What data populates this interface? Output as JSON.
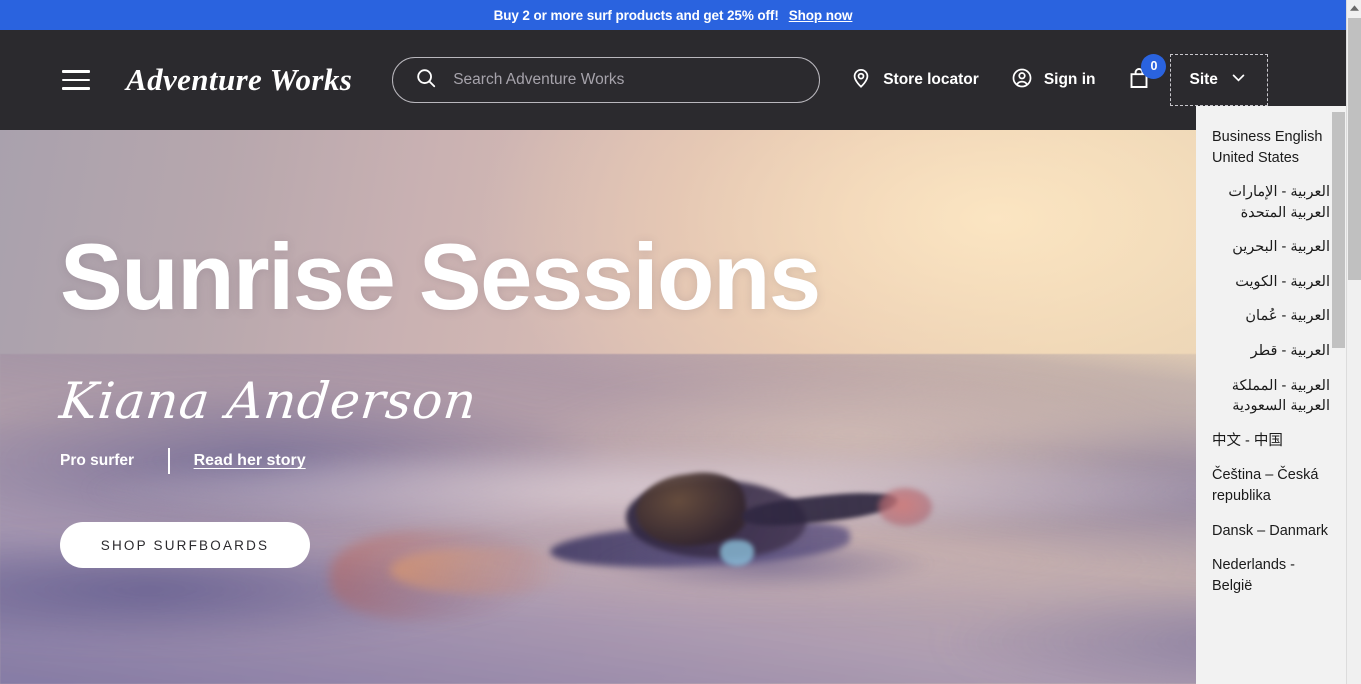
{
  "promo": {
    "text": "Buy 2 or more surf products and get 25% off!",
    "link_label": "Shop now",
    "background_color": "#2a63df"
  },
  "header": {
    "background_color": "#2b2a2e",
    "menu_icon": "hamburger-icon",
    "brand": "Adventure Works",
    "search": {
      "placeholder": "Search Adventure Works",
      "value": "",
      "icon": "search-icon"
    },
    "store_locator": {
      "label": "Store locator",
      "icon": "map-pin-icon"
    },
    "sign_in": {
      "label": "Sign in",
      "icon": "account-circle-icon"
    },
    "cart": {
      "icon": "shopping-bag-icon",
      "count": "0",
      "badge_color": "#2a63df"
    },
    "site_selector": {
      "label": "Site",
      "icon": "chevron-down-icon",
      "expanded": true
    }
  },
  "hero": {
    "title": "Sunrise Sessions",
    "signature": "Kiana Anderson",
    "role": "Pro surfer",
    "story_link": "Read her story",
    "cta_label": "SHOP SURFBOARDS"
  },
  "site_dropdown": {
    "items": [
      {
        "label": "Business English United States",
        "rtl": false
      },
      {
        "label": "العربية - الإمارات العربية المتحدة",
        "rtl": true
      },
      {
        "label": "العربية - البحرين",
        "rtl": true
      },
      {
        "label": "العربية - الكويت",
        "rtl": true
      },
      {
        "label": "العربية - عُمان",
        "rtl": true
      },
      {
        "label": "العربية - قطر",
        "rtl": true
      },
      {
        "label": "العربية - المملكة العربية السعودية",
        "rtl": true
      },
      {
        "label": "中文 - 中国",
        "rtl": false
      },
      {
        "label": "Čeština – Česká republika",
        "rtl": false
      },
      {
        "label": "Dansk – Danmark",
        "rtl": false
      },
      {
        "label": "Nederlands - België",
        "rtl": false
      }
    ]
  }
}
